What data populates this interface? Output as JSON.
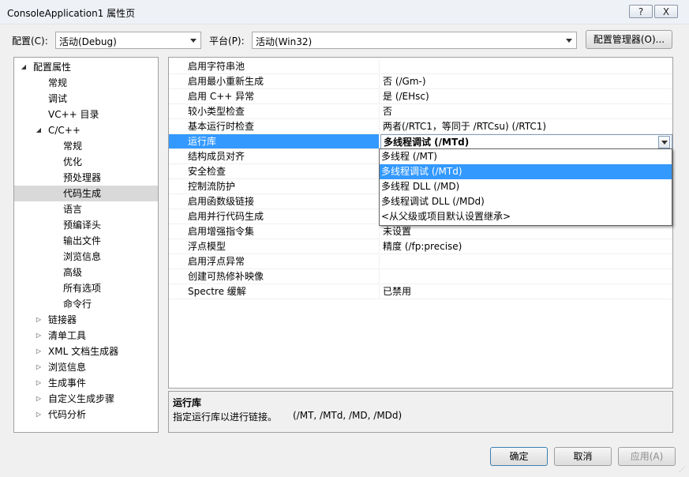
{
  "window": {
    "title": "ConsoleApplication1 属性页",
    "help_label": "?",
    "close_label": "X"
  },
  "toolbar": {
    "config_label": "配置(C):",
    "config_value": "活动(Debug)",
    "platform_label": "平台(P):",
    "platform_value": "活动(Win32)",
    "manager_label": "配置管理器(O)..."
  },
  "tree": {
    "root": "配置属性",
    "general": "常规",
    "debug": "调试",
    "vcpp_dirs": "VC++ 目录",
    "cpp": "C/C++",
    "cpp_children": [
      "常规",
      "优化",
      "预处理器",
      "代码生成",
      "语言",
      "预编译头",
      "输出文件",
      "浏览信息",
      "高级",
      "所有选项",
      "命令行"
    ],
    "others": [
      "链接器",
      "清单工具",
      "XML 文档生成器",
      "浏览信息",
      "生成事件",
      "自定义生成步骤",
      "代码分析"
    ]
  },
  "grid": {
    "rows": [
      {
        "name": "启用字符串池",
        "value": ""
      },
      {
        "name": "启用最小重新生成",
        "value": "否 (/Gm-)"
      },
      {
        "name": "启用 C++ 异常",
        "value": "是 (/EHsc)"
      },
      {
        "name": "较小类型检查",
        "value": "否"
      },
      {
        "name": "基本运行时检查",
        "value": "两者(/RTC1，等同于 /RTCsu) (/RTC1)"
      },
      {
        "name": "运行库",
        "value": "多线程调试 (/MTd)"
      },
      {
        "name": "结构成员对齐",
        "value": ""
      },
      {
        "name": "安全检查",
        "value": ""
      },
      {
        "name": "控制流防护",
        "value": ""
      },
      {
        "name": "启用函数级链接",
        "value": ""
      },
      {
        "name": "启用并行代码生成",
        "value": ""
      },
      {
        "name": "启用增强指令集",
        "value": "未设置"
      },
      {
        "name": "浮点模型",
        "value": "精度 (/fp:precise)"
      },
      {
        "name": "启用浮点异常",
        "value": ""
      },
      {
        "name": "创建可热修补映像",
        "value": ""
      },
      {
        "name": "Spectre 缓解",
        "value": "已禁用"
      }
    ]
  },
  "dropdown": {
    "options": [
      "多线程 (/MT)",
      "多线程调试 (/MTd)",
      "多线程 DLL (/MD)",
      "多线程调试 DLL (/MDd)",
      "<从父级或项目默认设置继承>"
    ]
  },
  "description": {
    "title": "运行库",
    "text": "指定运行库以进行链接。",
    "options": "(/MT, /MTd, /MD, /MDd)"
  },
  "buttons": {
    "ok": "确定",
    "cancel": "取消",
    "apply": "应用(A)"
  },
  "colors": {
    "selection": "#3399ff",
    "tree_selection": "#d9d9d9"
  }
}
